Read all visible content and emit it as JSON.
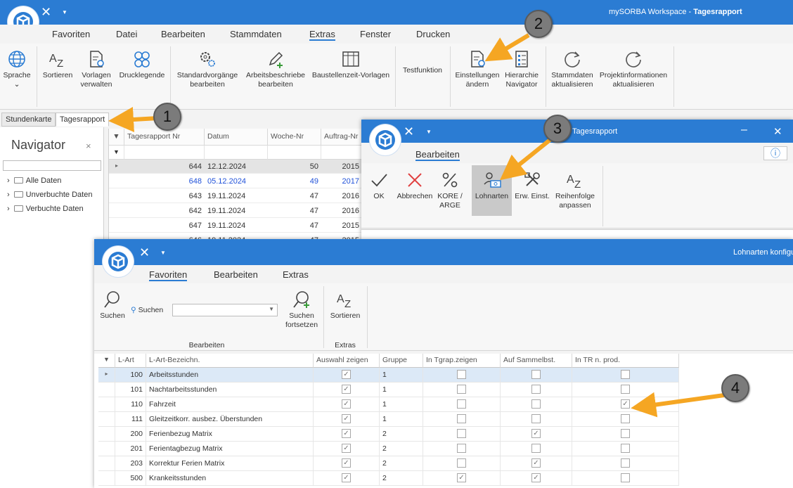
{
  "app": {
    "name": "mySORBA Workspace",
    "doc": "Tagesrapport"
  },
  "menu": [
    "Favoriten",
    "Datei",
    "Bearbeiten",
    "Stammdaten",
    "Extras",
    "Fenster",
    "Drucken"
  ],
  "ribbon": {
    "sprache": "Sprache",
    "sortieren": "Sortieren",
    "vorlagen": [
      "Vorlagen",
      "verwalten"
    ],
    "drucklegende": "Drucklegende",
    "standard": [
      "Standardvorgänge",
      "bearbeiten"
    ],
    "arbeitsbeschriebe": [
      "Arbeitsbeschriebe",
      "bearbeiten"
    ],
    "baustellenzeit": "Baustellenzeit-Vorlagen",
    "testfunktion": "Testfunktion",
    "einstellungen": [
      "Einstellungen",
      "ändern"
    ],
    "hierarchie": [
      "Hierarchie",
      "Navigator"
    ],
    "stammdaten": [
      "Stammdaten",
      "aktualisieren"
    ],
    "projektinfo": [
      "Projektinformationen",
      "aktualisieren"
    ]
  },
  "tabs": [
    "Stundenkarte",
    "Tagesrapport"
  ],
  "navigator": {
    "title": "Navigator",
    "close": "×",
    "items": [
      "Alle Daten",
      "Unverbuchte Daten",
      "Verbuchte Daten"
    ]
  },
  "grid1": {
    "headers": [
      "Tagesrapport Nr",
      "Datum",
      "Woche-Nr",
      "Auftrag-Nr"
    ],
    "rows": [
      [
        "644",
        "12.12.2024",
        "50",
        "2015"
      ],
      [
        "648",
        "05.12.2024",
        "49",
        "2017"
      ],
      [
        "643",
        "19.11.2024",
        "47",
        "2016"
      ],
      [
        "642",
        "19.11.2024",
        "47",
        "2016"
      ],
      [
        "647",
        "19.11.2024",
        "47",
        "2015"
      ],
      [
        "646",
        "19.11.2024",
        "47",
        "2015"
      ]
    ]
  },
  "dialog2": {
    "title": "Tagesrapport",
    "menu": "Bearbeiten",
    "info": "ⓘ",
    "buttons": {
      "ok": "OK",
      "abbrechen": "Abbrechen",
      "kore": [
        "KORE /",
        "ARGE"
      ],
      "lohnarten": "Lohnarten",
      "erw": "Erw. Einst.",
      "reihenfolge": [
        "Reihenfolge",
        "anpassen"
      ]
    }
  },
  "dialog3": {
    "title": "Lohnarten konfigu",
    "menu": [
      "Favoriten",
      "Bearbeiten",
      "Extras"
    ],
    "suchen": "Suchen",
    "suchen_label": "Suchen",
    "suchen_fortsetzen": [
      "Suchen",
      "fortsetzen"
    ],
    "sortieren": "Sortieren",
    "group_bearbeiten": "Bearbeiten",
    "group_extras": "Extras",
    "headers": [
      "L-Art",
      "L-Art-Bezeichn.",
      "Auswahl zeigen",
      "Gruppe",
      "In Tgrap.zeigen",
      "Auf Sammelbst.",
      "In TR n. prod."
    ],
    "rows": [
      {
        "nr": "100",
        "name": "Arbeitsstunden",
        "gruppe": "1",
        "auswahl": true,
        "tgrap": false,
        "sammel": false,
        "tr": false
      },
      {
        "nr": "101",
        "name": "Nachtarbeitsstunden",
        "gruppe": "1",
        "auswahl": true,
        "tgrap": false,
        "sammel": false,
        "tr": false
      },
      {
        "nr": "110",
        "name": "Fahrzeit",
        "gruppe": "1",
        "auswahl": true,
        "tgrap": false,
        "sammel": false,
        "tr": true
      },
      {
        "nr": "111",
        "name": "Gleitzeitkorr. ausbez. Überstunden",
        "gruppe": "1",
        "auswahl": true,
        "tgrap": false,
        "sammel": false,
        "tr": false
      },
      {
        "nr": "200",
        "name": "Ferienbezug Matrix",
        "gruppe": "2",
        "auswahl": true,
        "tgrap": false,
        "sammel": true,
        "tr": false
      },
      {
        "nr": "201",
        "name": "Ferientagbezug Matrix",
        "gruppe": "2",
        "auswahl": true,
        "tgrap": false,
        "sammel": false,
        "tr": false
      },
      {
        "nr": "203",
        "name": "Korrektur Ferien Matrix",
        "gruppe": "2",
        "auswahl": true,
        "tgrap": false,
        "sammel": true,
        "tr": false
      },
      {
        "nr": "500",
        "name": "Krankeitsstunden",
        "gruppe": "2",
        "auswahl": true,
        "tgrap": true,
        "sammel": true,
        "tr": false
      }
    ]
  },
  "badges": [
    "1",
    "2",
    "3",
    "4"
  ],
  "colors": {
    "accent": "#2b7cd3",
    "arrow": "#f5a623",
    "link": "#2152d9"
  }
}
